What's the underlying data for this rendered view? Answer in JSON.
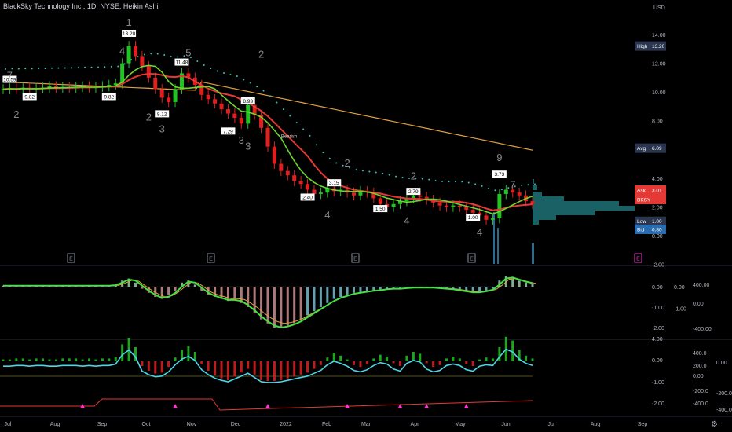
{
  "header": {
    "title": "BlackSky Technology Inc., 1D, NYSE, Heikin Ashi",
    "currency": "USD"
  },
  "colors": {
    "background": "#000000",
    "up": "#22c322",
    "down": "#e02020",
    "ma_red": "#e53935",
    "ma_green": "#6bd630",
    "ma_orange": "#e0a040",
    "dots_cyan": "#2ec4b6",
    "dots_red": "#ff3b3b",
    "cyan_line": "#4dd6e8",
    "volume_profile": "#1d6b70",
    "label_bg": "#2a3550",
    "ask_bg": "#e53935",
    "bksy_bg": "#e53935",
    "bid_bg": "#2a6cb0"
  },
  "chart_data": [
    {
      "type": "candlestick",
      "panel": "price",
      "x_ticks": [
        "Jul",
        "Aug",
        "Sep",
        "Oct",
        "Nov",
        "Dec",
        "2022",
        "Feb",
        "Mar",
        "Apr",
        "May",
        "Jun",
        "Jul",
        "Aug",
        "Sep"
      ],
      "y_ticks": [
        "14.00",
        "12.00",
        "10.00",
        "8.00",
        "6.00",
        "4.00",
        "2.00",
        "0.00",
        "-2.00"
      ],
      "ylim": [
        -2,
        15
      ],
      "close": [
        [
          0,
          10.2
        ],
        [
          1,
          10.25
        ],
        [
          2,
          10.2
        ],
        [
          3,
          10.3
        ],
        [
          4,
          10.2
        ],
        [
          5,
          10.25
        ],
        [
          6,
          10.3
        ],
        [
          7,
          10.4
        ],
        [
          8,
          10.3
        ],
        [
          9,
          10.35
        ],
        [
          10,
          10.3
        ],
        [
          11,
          10.35
        ],
        [
          12,
          10.4
        ],
        [
          13,
          10.3
        ],
        [
          14,
          10.35
        ],
        [
          15,
          10.4
        ],
        [
          16,
          10.5
        ],
        [
          17,
          10.6
        ],
        [
          18,
          12.0
        ],
        [
          19,
          13.2
        ],
        [
          20,
          12.5
        ],
        [
          21,
          11.8
        ],
        [
          22,
          11.0
        ],
        [
          23,
          10.2
        ],
        [
          24,
          9.6
        ],
        [
          25,
          9.3
        ],
        [
          26,
          10.2
        ],
        [
          27,
          11.3
        ],
        [
          28,
          11.0
        ],
        [
          29,
          10.5
        ],
        [
          30,
          9.8
        ],
        [
          31,
          9.5
        ],
        [
          32,
          9.2
        ],
        [
          33,
          8.8
        ],
        [
          34,
          8.5
        ],
        [
          35,
          8.2
        ],
        [
          36,
          7.8
        ],
        [
          37,
          9.1
        ],
        [
          38,
          8.4
        ],
        [
          39,
          7.5
        ],
        [
          40,
          6.2
        ],
        [
          41,
          5.0
        ],
        [
          42,
          4.5
        ],
        [
          43,
          4.2
        ],
        [
          44,
          3.8
        ],
        [
          45,
          3.6
        ],
        [
          46,
          3.2
        ],
        [
          47,
          2.9
        ],
        [
          48,
          3.0
        ],
        [
          49,
          3.3
        ],
        [
          50,
          3.1
        ],
        [
          51,
          3.2
        ],
        [
          52,
          3.0
        ],
        [
          53,
          2.8
        ],
        [
          54,
          3.1
        ],
        [
          55,
          3.0
        ],
        [
          56,
          2.6
        ],
        [
          57,
          2.2
        ],
        [
          58,
          2.0
        ],
        [
          59,
          2.2
        ],
        [
          60,
          2.4
        ],
        [
          61,
          2.6
        ],
        [
          62,
          2.8
        ],
        [
          63,
          2.7
        ],
        [
          64,
          2.5
        ],
        [
          65,
          2.3
        ],
        [
          66,
          2.1
        ],
        [
          67,
          2.0
        ],
        [
          68,
          2.1
        ],
        [
          69,
          2.0
        ],
        [
          70,
          1.8
        ],
        [
          71,
          1.6
        ],
        [
          72,
          1.4
        ],
        [
          73,
          1.1
        ],
        [
          74,
          1.2
        ],
        [
          75,
          2.9
        ],
        [
          76,
          3.2
        ],
        [
          77,
          3.0
        ],
        [
          78,
          2.8
        ],
        [
          79,
          2.4
        ],
        [
          80,
          2.2
        ]
      ],
      "annotations": [
        "10.59",
        "9.82",
        "13.20",
        "9.82",
        "8.12",
        "11.48",
        "7.29",
        "8.93",
        "3.15",
        "2.40",
        "2.79",
        "1.50",
        "3.73",
        "1.00"
      ],
      "count_labels": [
        "7",
        "2",
        "1",
        "4",
        "2",
        "3",
        "5",
        "3",
        "2",
        "3",
        "2",
        "4",
        "2",
        "4",
        "9",
        "4",
        "7"
      ],
      "other_labels": [
        "Bearish"
      ],
      "event_markers": [
        "E",
        "E",
        "E",
        "E",
        "E"
      ],
      "price_labels": {
        "high_label": "High",
        "high_value": "13.20",
        "avg_label": "Avg",
        "avg_value": "6.09",
        "ask_label": "Ask",
        "ask_value": "3.01",
        "bksy_label": "BKSY",
        "low_label": "Low",
        "low_value": "1.00",
        "bid_label": "Bid",
        "bid_value": "0.80"
      }
    },
    {
      "type": "histogram",
      "panel": "oscillator-1",
      "y_ticks": [
        "0.00",
        "-1.00",
        "-2.00"
      ],
      "y_ticks_2": [
        "0.00",
        "-1.00"
      ],
      "y_ticks_3": [
        "400.00",
        "0.00",
        "-400.00"
      ],
      "ylim": [
        -2.1,
        0.5
      ],
      "values": [
        0.05,
        0.05,
        0.05,
        0.05,
        0.05,
        0.05,
        0.05,
        0.05,
        0.05,
        0.05,
        0.05,
        0.05,
        0.05,
        0.05,
        0.05,
        0.05,
        0.05,
        0.1,
        0.3,
        0.4,
        0.2,
        -0.1,
        -0.3,
        -0.5,
        -0.6,
        -0.4,
        -0.2,
        0.2,
        0.3,
        0.1,
        -0.2,
        -0.4,
        -0.5,
        -0.6,
        -0.7,
        -0.6,
        -0.8,
        -1.0,
        -1.3,
        -1.6,
        -1.8,
        -2.0,
        -2.0,
        -1.9,
        -1.8,
        -1.6,
        -1.4,
        -1.2,
        -1.0,
        -0.8,
        -0.6,
        -0.5,
        -0.4,
        -0.3,
        -0.3,
        -0.2,
        -0.2,
        -0.15,
        -0.1,
        -0.1,
        -0.1,
        -0.05,
        -0.05,
        -0.05,
        -0.05,
        -0.05,
        -0.1,
        -0.1,
        -0.15,
        -0.2,
        -0.25,
        -0.3,
        -0.25,
        -0.2,
        -0.1,
        0.3,
        0.5,
        0.4,
        0.3,
        0.2,
        0.15
      ]
    },
    {
      "type": "histogram",
      "panel": "oscillator-2",
      "y_ticks": [
        "4.00",
        "0.00",
        "-1.00",
        "-2.00"
      ],
      "y_ticks_2": [
        "400.0",
        "200.0",
        "0.00",
        "-200.0",
        "-400.0"
      ],
      "y_ticks_3": [
        "0.00",
        "-200.00",
        "-400.00"
      ],
      "ylim": [
        -2.2,
        4.2
      ],
      "values": [
        0.2,
        0.2,
        0.3,
        0.3,
        0.2,
        0.3,
        0.3,
        0.2,
        0.2,
        0.3,
        0.3,
        0.3,
        0.2,
        0.3,
        0.2,
        0.3,
        0.3,
        0.5,
        1.8,
        2.5,
        1.5,
        -0.5,
        -1.0,
        -1.3,
        -1.2,
        -0.6,
        0.4,
        1.2,
        1.6,
        1.0,
        -0.3,
        -1.0,
        -1.5,
        -1.8,
        -2.0,
        -1.6,
        -1.2,
        -0.8,
        -1.4,
        -2.0,
        -2.1,
        -2.1,
        -2.0,
        -1.8,
        -1.6,
        -1.4,
        -1.2,
        -0.8,
        -0.4,
        0.4,
        0.9,
        0.6,
        0.2,
        -0.4,
        -0.6,
        -0.3,
        0.3,
        0.7,
        0.5,
        -0.2,
        -0.5,
        0.6,
        1.0,
        0.8,
        -0.2,
        -0.6,
        -0.4,
        0.3,
        0.5,
        0.3,
        -0.3,
        -0.5,
        0.2,
        0.4,
        0.3,
        1.5,
        2.6,
        2.2,
        1.2,
        0.6,
        0.3
      ]
    }
  ]
}
